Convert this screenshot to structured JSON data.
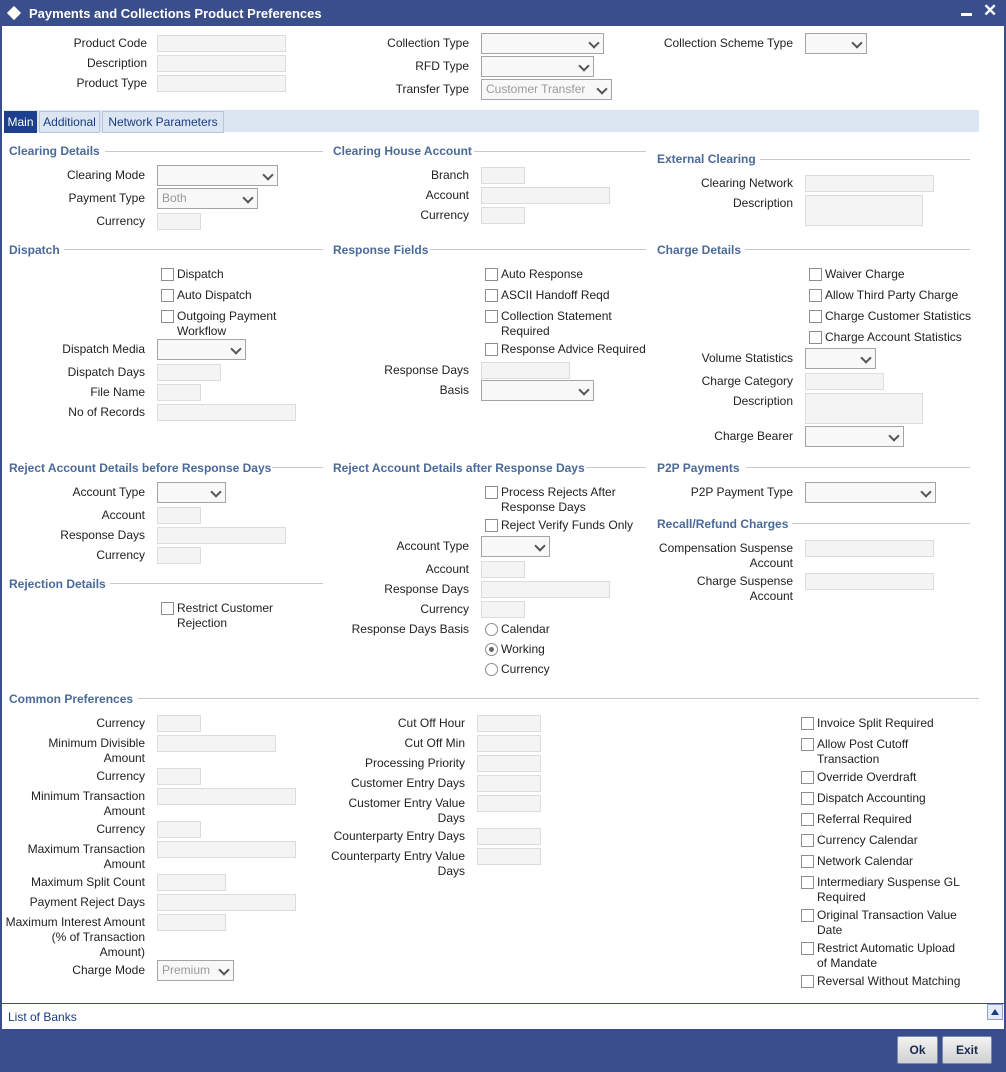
{
  "window": {
    "title": "Payments and Collections Product Preferences"
  },
  "header": {
    "product_code_label": "Product Code",
    "description_label": "Description",
    "product_type_label": "Product Type",
    "collection_type_label": "Collection Type",
    "rfd_type_label": "RFD Type",
    "transfer_type_label": "Transfer Type",
    "transfer_type_value": "Customer Transfer",
    "collection_scheme_type_label": "Collection Scheme Type"
  },
  "tabs": [
    {
      "label": "Main"
    },
    {
      "label": "Additional"
    },
    {
      "label": "Network Parameters"
    }
  ],
  "clearing_details": {
    "title": "Clearing Details",
    "clearing_mode_label": "Clearing Mode",
    "payment_type_label": "Payment Type",
    "payment_type_value": "Both",
    "currency_label": "Currency"
  },
  "clearing_house": {
    "title": "Clearing House Account",
    "branch_label": "Branch",
    "account_label": "Account",
    "currency_label": "Currency"
  },
  "external_clearing": {
    "title": "External Clearing",
    "clearing_network_label": "Clearing Network",
    "description_label": "Description"
  },
  "dispatch": {
    "title": "Dispatch",
    "dispatch_cb": "Dispatch",
    "auto_dispatch_cb": "Auto Dispatch",
    "outgoing_wf_1": "Outgoing Payment",
    "outgoing_wf_2": "Workflow",
    "media_label": "Dispatch Media",
    "days_label": "Dispatch Days",
    "file_label": "File Name",
    "records_label": "No of Records"
  },
  "response_fields": {
    "title": "Response Fields",
    "auto_response": "Auto Response",
    "ascii_handoff": "ASCII Handoff Reqd",
    "coll_stmt_1": "Collection Statement",
    "coll_stmt_2": "Required",
    "resp_advice": "Response Advice Required",
    "response_days_label": "Response Days",
    "basis_label": "Basis"
  },
  "charge_details": {
    "title": "Charge Details",
    "waiver": "Waiver Charge",
    "third_party": "Allow Third Party Charge",
    "cust_stats": "Charge Customer Statistics",
    "acct_stats": "Charge Account Statistics",
    "volume_label": "Volume Statistics",
    "category_label": "Charge Category",
    "description_label": "Description",
    "bearer_label": "Charge Bearer"
  },
  "reject_before": {
    "title": "Reject Account Details before Response Days",
    "account_type_label": "Account Type",
    "account_label": "Account",
    "response_days_label": "Response Days",
    "currency_label": "Currency"
  },
  "reject_after": {
    "title": "Reject Account Details after Response Days",
    "process_rejects_1": "Process Rejects After",
    "process_rejects_2": "Response Days",
    "reject_verify": "Reject Verify Funds Only",
    "account_type_label": "Account Type",
    "account_label": "Account",
    "response_days_label": "Response Days",
    "currency_label": "Currency",
    "basis_label": "Response Days Basis",
    "basis_options": [
      "Calendar",
      "Working",
      "Currency"
    ]
  },
  "p2p": {
    "title": "P2P Payments",
    "type_label": "P2P Payment Type"
  },
  "recall": {
    "title": "Recall/Refund Charges",
    "comp_1": "Compensation Suspense",
    "comp_2": "Account",
    "charge_1": "Charge Suspense",
    "charge_2": "Account"
  },
  "rejection": {
    "title": "Rejection Details",
    "restrict_1": "Restrict Customer",
    "restrict_2": "Rejection"
  },
  "common": {
    "title": "Common Preferences",
    "currency_label": "Currency",
    "min_div_1": "Minimum Divisible",
    "min_div_2": "Amount",
    "min_txn_1": "Minimum Transaction",
    "min_txn_2": "Amount",
    "max_txn_1": "Maximum Transaction",
    "max_txn_2": "Amount",
    "max_split": "Maximum Split Count",
    "reject_days": "Payment Reject Days",
    "max_int_1": "Maximum Interest Amount",
    "max_int_2": "(% of Transaction",
    "max_int_3": "Amount)",
    "charge_mode": "Charge Mode",
    "charge_mode_value": "Premium",
    "cutoff_hour": "Cut Off Hour",
    "cutoff_min": "Cut Off Min",
    "priority": "Processing Priority",
    "cust_entry_days": "Customer Entry Days",
    "cust_val_1": "Customer Entry Value",
    "cust_val_2": "Days",
    "cp_entry_days": "Counterparty Entry Days",
    "cp_val_1": "Counterparty Entry Value",
    "cp_val_2": "Days",
    "invoice_split": "Invoice Split Required",
    "post_cutoff_1": "Allow Post Cutoff",
    "post_cutoff_2": "Transaction",
    "override_od": "Override Overdraft",
    "dispatch_acct": "Dispatch Accounting",
    "referral": "Referral Required",
    "ccy_cal": "Currency Calendar",
    "net_cal": "Network Calendar",
    "inter_susp_1": "Intermediary Suspense GL",
    "inter_susp_2": "Required",
    "orig_val_1": "Original Transaction Value",
    "orig_val_2": "Date",
    "restrict_upload_1": "Restrict Automatic Upload",
    "restrict_upload_2": "of Mandate",
    "reversal": "Reversal Without Matching"
  },
  "footer": {
    "list_of_banks": "List of Banks",
    "ok": "Ok",
    "exit": "Exit"
  }
}
